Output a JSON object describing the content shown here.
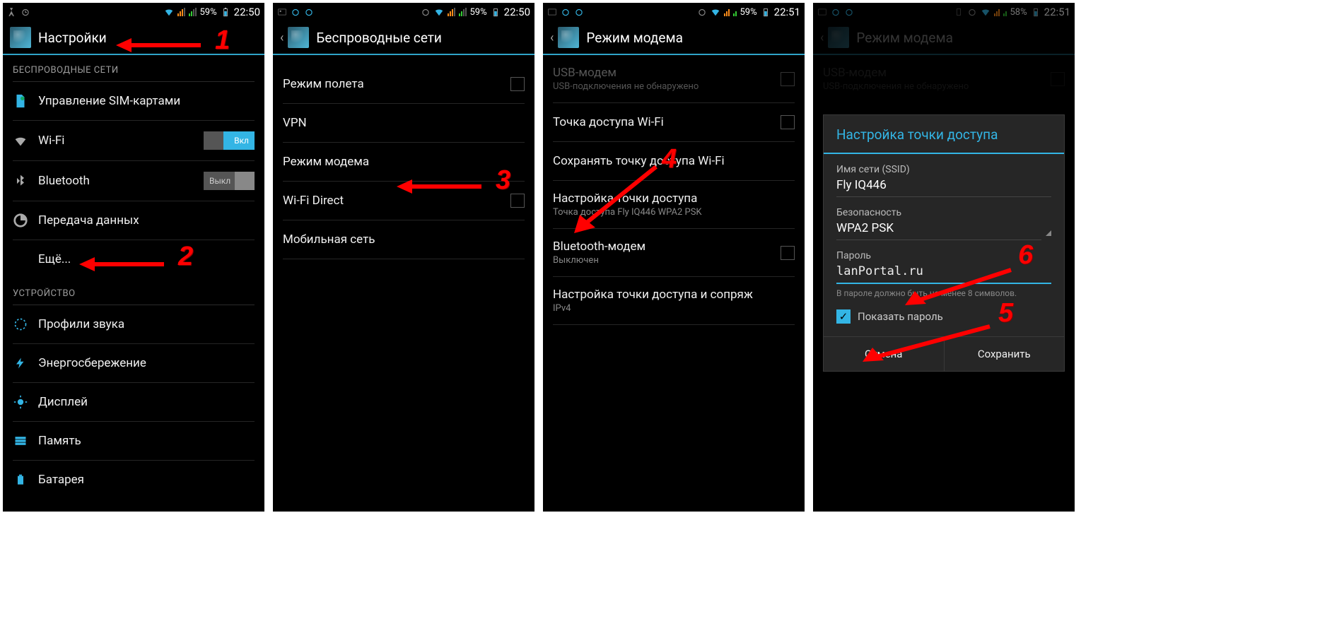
{
  "status": {
    "battery": [
      "59%",
      "59%",
      "59%",
      "58%"
    ],
    "time": [
      "22:50",
      "22:50",
      "22:51",
      "22:51"
    ]
  },
  "screen1": {
    "title": "Настройки",
    "section_wireless": "БЕСПРОВОДНЫЕ СЕТИ",
    "sim": "Управление SIM-картами",
    "wifi": "Wi-Fi",
    "wifi_toggle": "Вкл",
    "bt": "Bluetooth",
    "bt_toggle": "Выкл",
    "datausage": "Передача данных",
    "more": "Ещё...",
    "section_device": "УСТРОЙСТВО",
    "sound": "Профили звука",
    "power": "Энергосбережение",
    "display": "Дисплей",
    "storage": "Память",
    "battery": "Батарея"
  },
  "screen2": {
    "title": "Беспроводные сети",
    "airplane": "Режим полета",
    "vpn": "VPN",
    "tether": "Режим модема",
    "wfd": "Wi-Fi Direct",
    "mobile": "Мобильная сеть"
  },
  "screen3": {
    "title": "Режим модема",
    "usb": "USB-модем",
    "usb_sub": "USB-подключения не обнаружено",
    "ap": "Точка доступа Wi-Fi",
    "ap_keep": "Сохранять точку доступа Wi-Fi",
    "ap_cfg": "Настройка точки доступа",
    "ap_cfg_sub": "Точка доступа Fly IQ446 WPA2 PSK",
    "btm": "Bluetooth-модем",
    "btm_sub": "Выключен",
    "pair": "Настройка точки доступа и сопряж",
    "pair_sub": "IPv4"
  },
  "screen4": {
    "title": "Режим модема",
    "usb": "USB-модем",
    "usb_sub": "USB-подключения не обнаружено",
    "dialog_title": "Настройка точки доступа",
    "ssid_lbl": "Имя сети (SSID)",
    "ssid_val": "Fly IQ446",
    "sec_lbl": "Безопасность",
    "sec_val": "WPA2 PSK",
    "pwd_lbl": "Пароль",
    "pwd_val": "lanPortal.ru",
    "pwd_hint": "В пароле должно быть не менее 8 символов.",
    "show_pwd": "Показать пароль",
    "cancel": "Отмена",
    "save": "Сохранить"
  },
  "annotations": [
    "1",
    "2",
    "3",
    "4",
    "5",
    "6"
  ]
}
